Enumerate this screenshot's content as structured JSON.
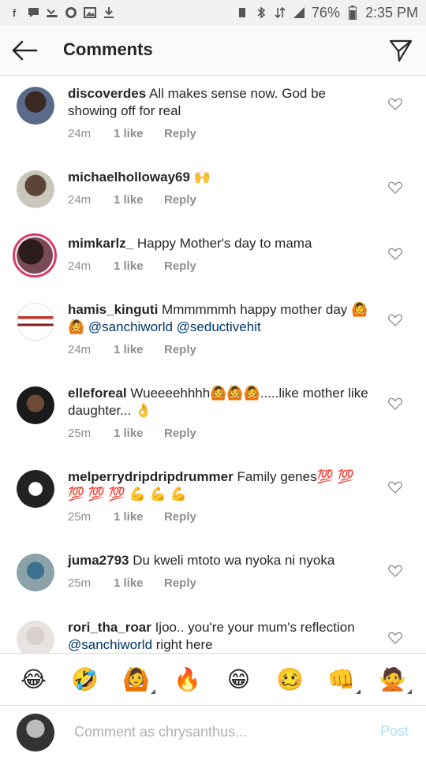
{
  "status_bar": {
    "icons_left": [
      "facebook-icon",
      "message-icon",
      "missed-call-icon",
      "whatsapp-icon",
      "gallery-icon",
      "download-icon"
    ],
    "battery": "76%",
    "time": "2:35 PM"
  },
  "header": {
    "title": "Comments"
  },
  "comments": [
    {
      "username": "discoverdes",
      "text": "All makes sense now. God be showing off for real",
      "time": "24m",
      "likes": "1 like",
      "reply": "Reply"
    },
    {
      "username": "michaelholloway69",
      "text": "🙌",
      "time": "24m",
      "likes": "1 like",
      "reply": "Reply"
    },
    {
      "username": "mimkarlz_",
      "text": "Happy Mother's day to mama",
      "time": "24m",
      "likes": "1 like",
      "reply": "Reply"
    },
    {
      "username": "hamis_kinguti",
      "text": "Mmmmmmh happy mother day 🙆🙆",
      "mentions": "@sanchiworld @seductivehit",
      "time": "24m",
      "likes": "1 like",
      "reply": "Reply"
    },
    {
      "username": "elleforeal",
      "text": "Wueeeehhhh🙆🙆🙆.....like mother like daughter... 👌",
      "time": "25m",
      "likes": "1 like",
      "reply": "Reply"
    },
    {
      "username": "melperrydripdripdrummer",
      "text": "Family genes💯 💯 💯 💯 💯 💪 💪 💪",
      "time": "25m",
      "likes": "1 like",
      "reply": "Reply"
    },
    {
      "username": "juma2793",
      "text": "Du kweli mtoto wa nyoka ni nyoka",
      "time": "25m",
      "likes": "1 like",
      "reply": "Reply"
    },
    {
      "username": "rori_tha_roar",
      "text": "Ijoo.. you're your mum's reflection",
      "mentions": "@sanchiworld",
      "text_after": "right here"
    }
  ],
  "emoji_bar": [
    "😂",
    "🤣",
    "🙆",
    "🔥",
    "😁",
    "🥴",
    "👊",
    "🙅"
  ],
  "composer": {
    "placeholder": "Comment as chrysanthus...",
    "post_label": "Post"
  },
  "colors": {
    "mention": "#003569",
    "meta": "#8e8e8e",
    "post": "#b2dffc",
    "story_ring": "#d93a6b"
  }
}
